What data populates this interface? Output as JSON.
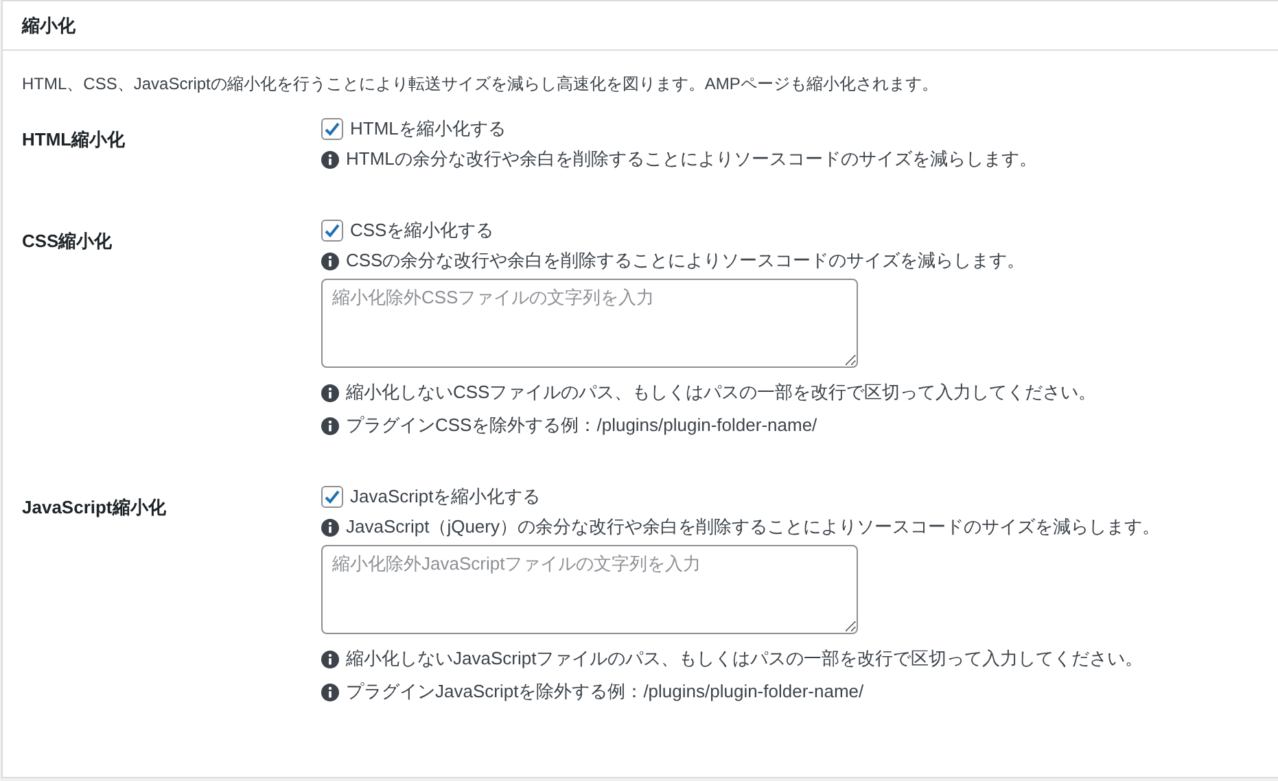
{
  "panel": {
    "title": "縮小化",
    "description": "HTML、CSS、JavaScriptの縮小化を行うことにより転送サイズを減らし高速化を図ります。AMPページも縮小化されます。"
  },
  "settings": [
    {
      "label": "HTML縮小化",
      "items": [
        {
          "kind": "checkbox",
          "label": "HTMLを縮小化する",
          "checked": true
        },
        {
          "kind": "note",
          "text": "HTMLの余分な改行や余白を削除することによりソースコードのサイズを減らします。"
        }
      ]
    },
    {
      "label": "CSS縮小化",
      "items": [
        {
          "kind": "checkbox",
          "label": "CSSを縮小化する",
          "checked": true
        },
        {
          "kind": "note",
          "text": "CSSの余分な改行や余白を削除することによりソースコードのサイズを減らします。"
        },
        {
          "kind": "textarea",
          "placeholder": "縮小化除外CSSファイルの文字列を入力"
        },
        {
          "kind": "note",
          "text": "縮小化しないCSSファイルのパス、もしくはパスの一部を改行で区切って入力してください。"
        },
        {
          "kind": "note",
          "text": "プラグインCSSを除外する例：/plugins/plugin-folder-name/"
        }
      ]
    },
    {
      "label": "JavaScript縮小化",
      "items": [
        {
          "kind": "checkbox",
          "label": "JavaScriptを縮小化する",
          "checked": true
        },
        {
          "kind": "note",
          "text": "JavaScript（jQuery）の余分な改行や余白を削除することによりソースコードのサイズを減らします。"
        },
        {
          "kind": "textarea",
          "placeholder": "縮小化除外JavaScriptファイルの文字列を入力"
        },
        {
          "kind": "note",
          "text": "縮小化しないJavaScriptファイルのパス、もしくはパスの一部を改行で区切って入力してください。"
        },
        {
          "kind": "note",
          "text": "プラグインJavaScriptを除外する例：/plugins/plugin-folder-name/"
        }
      ]
    }
  ]
}
